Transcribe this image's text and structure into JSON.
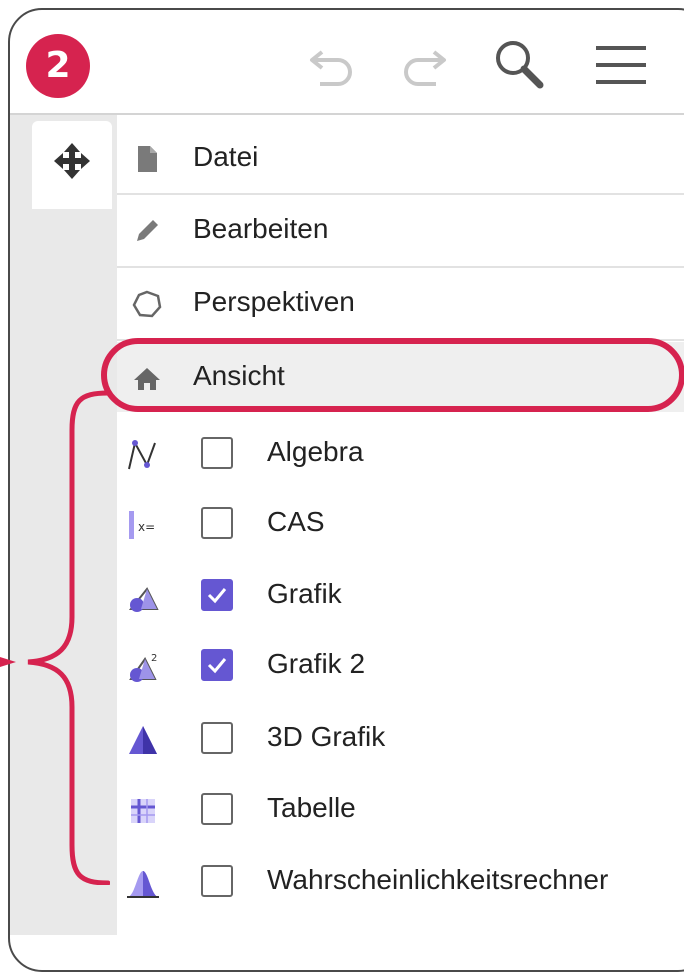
{
  "step_badge": "2",
  "toolbar": {
    "icons": [
      "undo-icon",
      "redo-icon",
      "search-icon",
      "hamburger-menu-icon"
    ]
  },
  "colors": {
    "accent": "#d6234f",
    "checkbox_checked": "#6557d2",
    "view_icon": "#6557d2"
  },
  "menu": {
    "items": [
      {
        "label": "Datei",
        "icon": "file-icon"
      },
      {
        "label": "Bearbeiten",
        "icon": "pencil-icon"
      },
      {
        "label": "Perspektiven",
        "icon": "perspectives-icon"
      },
      {
        "label": "Ansicht",
        "icon": "home-icon",
        "active": true
      }
    ]
  },
  "views": [
    {
      "label": "Algebra",
      "checked": false,
      "icon": "algebra-icon"
    },
    {
      "label": "CAS",
      "checked": false,
      "icon": "cas-icon"
    },
    {
      "label": "Grafik",
      "checked": true,
      "icon": "graphics-icon"
    },
    {
      "label": "Grafik 2",
      "checked": true,
      "icon": "graphics-2-icon"
    },
    {
      "label": "3D Grafik",
      "checked": false,
      "icon": "graphics-3d-icon"
    },
    {
      "label": "Tabelle",
      "checked": false,
      "icon": "spreadsheet-icon"
    },
    {
      "label": "Wahrscheinlichkeitsrechner",
      "checked": false,
      "icon": "probability-calculator-icon"
    }
  ]
}
